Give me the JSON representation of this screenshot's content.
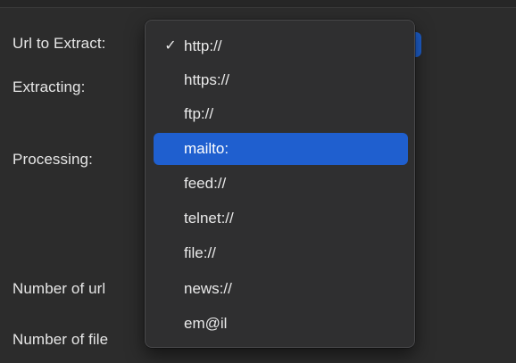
{
  "form": {
    "url_to_extract_label": "Url to Extract:",
    "extracting_label": "Extracting:",
    "processing_label": "Processing:",
    "number_of_url_label": "Number of url",
    "number_of_file_label": "Number of file"
  },
  "dropdown": {
    "selected_value": "http://",
    "highlighted_value": "mailto:",
    "check_glyph": "✓",
    "options": [
      {
        "label": "http://",
        "checked": true,
        "highlighted": false
      },
      {
        "label": "https://",
        "checked": false,
        "highlighted": false
      },
      {
        "label": "ftp://",
        "checked": false,
        "highlighted": false
      },
      {
        "label": "mailto:",
        "checked": false,
        "highlighted": true
      },
      {
        "label": "feed://",
        "checked": false,
        "highlighted": false
      },
      {
        "label": "telnet://",
        "checked": false,
        "highlighted": false
      },
      {
        "label": "file://",
        "checked": false,
        "highlighted": false
      },
      {
        "label": "news://",
        "checked": false,
        "highlighted": false
      },
      {
        "label": "em@il",
        "checked": false,
        "highlighted": false
      }
    ]
  },
  "colors": {
    "accent": "#1f5fcf",
    "background": "#2c2c2c",
    "menu_background": "#2f2f30",
    "text": "#e7e7e7"
  }
}
